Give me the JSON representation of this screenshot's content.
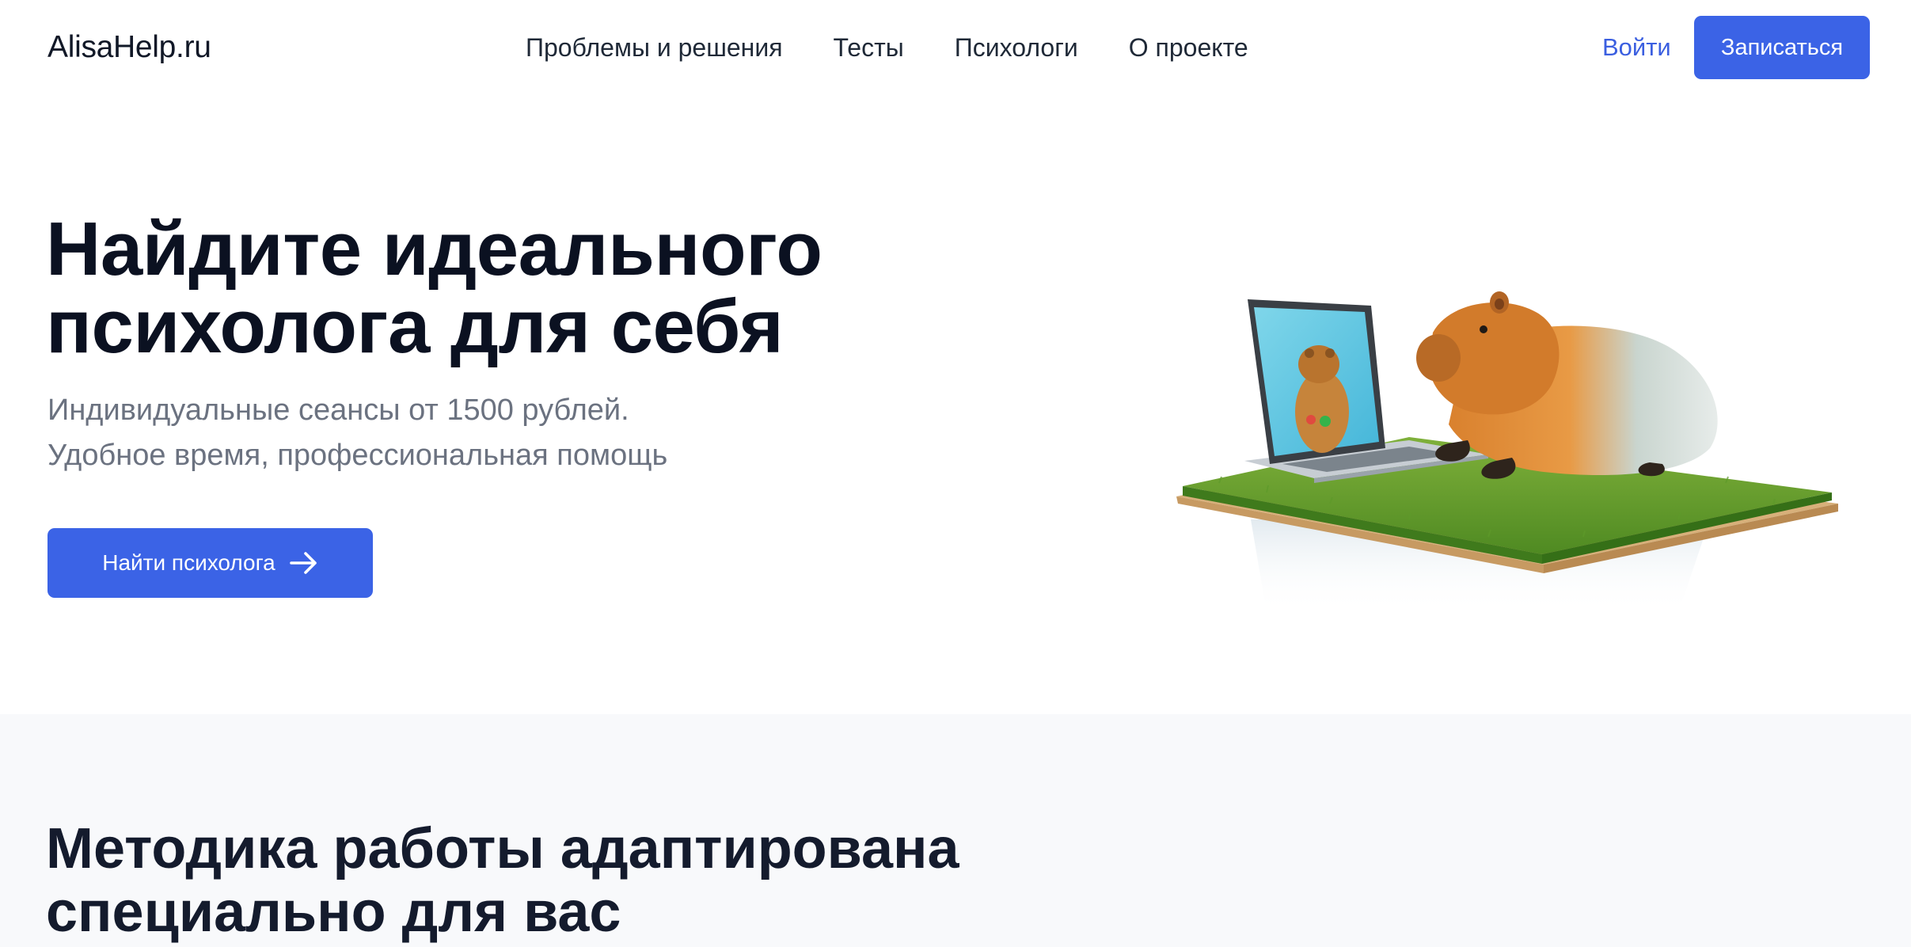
{
  "header": {
    "logo": "AlisaHelp.ru",
    "nav": [
      {
        "label": "Проблемы и решения"
      },
      {
        "label": "Тесты"
      },
      {
        "label": "Психологи"
      },
      {
        "label": "О проекте"
      }
    ],
    "login_label": "Войти",
    "signup_label": "Записаться"
  },
  "hero": {
    "title": "Найдите идеального психолога для себя",
    "subtitle_line1": "Индивидуальные сеансы от 1500 рублей.",
    "subtitle_line2": "Удобное время, профессиональная помощь",
    "cta_label": "Найти психолога",
    "cta_icon": "arrow-right-icon"
  },
  "method": {
    "title_line1": "Методика работы адаптирована",
    "title_line2": "специально для вас"
  },
  "colors": {
    "accent": "#3b63e6",
    "link": "#3b5fe0",
    "heading": "#0b1121",
    "muted": "#6b7280",
    "section_bg": "#f8f9fb"
  }
}
